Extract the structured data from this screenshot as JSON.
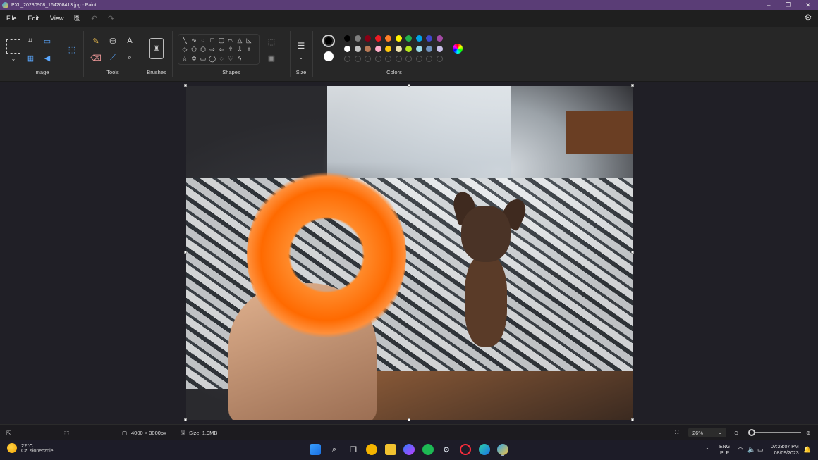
{
  "window": {
    "title": "PXL_20230908_164208413.jpg - Paint"
  },
  "menu": {
    "file": "File",
    "edit": "Edit",
    "view": "View"
  },
  "ribbon": {
    "groups": {
      "image": "Image",
      "tools": "Tools",
      "brushes": "Brushes",
      "shapes": "Shapes",
      "size": "Size",
      "colors": "Colors"
    },
    "primary_color": "#000000",
    "secondary_color": "#ffffff",
    "palette_row1": [
      "#000000",
      "#7f7f7f",
      "#880015",
      "#ed1c24",
      "#ff7f27",
      "#fff200",
      "#22b14c",
      "#00a2e8",
      "#3f48cc",
      "#a349a4"
    ],
    "palette_row2": [
      "#ffffff",
      "#c3c3c3",
      "#b97a57",
      "#ffaec9",
      "#ffc90e",
      "#efe4b0",
      "#b5e61d",
      "#99d9ea",
      "#7092be",
      "#c8bfe7"
    ]
  },
  "status": {
    "image_size": "4000 × 3000px",
    "file_size": "Size: 1.9MB",
    "zoom": "26%",
    "zoom_fraction": 0.05
  },
  "taskbar": {
    "weather_temp": "22°C",
    "weather_desc": "Cz. słonecznie",
    "lang": "ENG",
    "layout": "PLP",
    "time": "07:23:07 PM",
    "date": "08/09/2023"
  }
}
